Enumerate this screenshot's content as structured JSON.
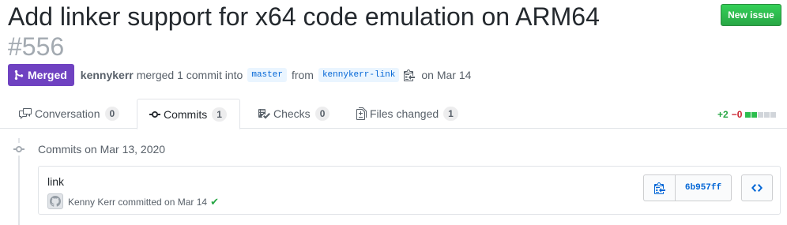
{
  "header": {
    "title": "Add linker support for x64 code emulation on ARM64",
    "number": "#556",
    "new_issue_label": "New issue"
  },
  "meta": {
    "state_label": "Merged",
    "author": "kennykerr",
    "text_merged": "merged 1 commit into",
    "base_branch": "master",
    "text_from": "from",
    "head_branch": "kennykerr-link",
    "text_date": "on Mar 14"
  },
  "tabs": [
    {
      "label": "Conversation",
      "count": "0",
      "icon": "comment-discussion-icon"
    },
    {
      "label": "Commits",
      "count": "1",
      "icon": "git-commit-icon"
    },
    {
      "label": "Checks",
      "count": "0",
      "icon": "checklist-icon"
    },
    {
      "label": "Files changed",
      "count": "1",
      "icon": "file-diff-icon"
    }
  ],
  "diffstat": {
    "additions": "+2",
    "deletions": "−0",
    "blocks_green": 2,
    "blocks_total": 5
  },
  "timeline": {
    "heading": "Commits on Mar 13, 2020",
    "commit": {
      "message": "link",
      "author_line": "Kenny Kerr committed on Mar 14",
      "sha": "6b957ff",
      "status": "success"
    }
  },
  "colors": {
    "merged": "#6f42c1",
    "new_issue": "#28a745",
    "link": "#0366d6",
    "added": "#28a745",
    "deleted": "#cb2431"
  }
}
